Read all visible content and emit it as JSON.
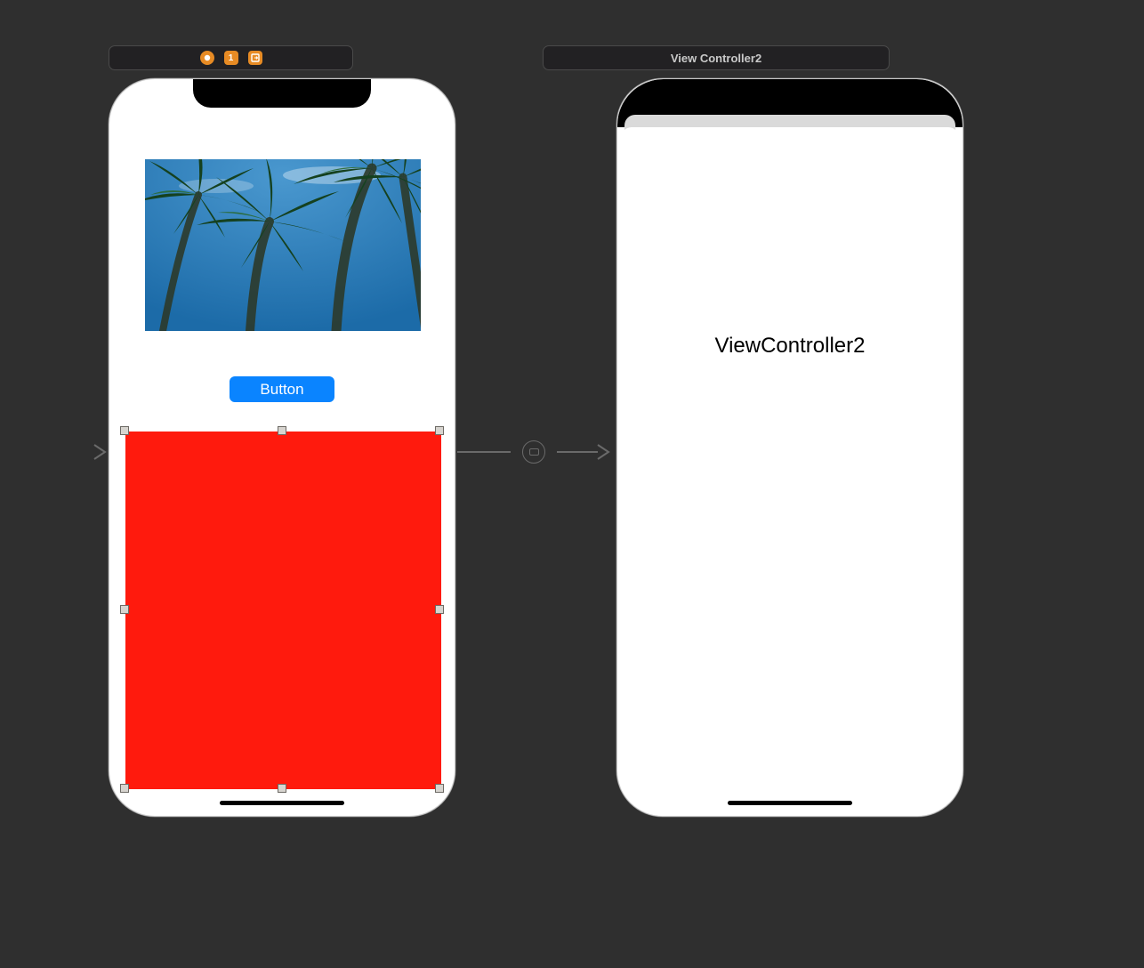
{
  "scene1": {
    "toolbar": {
      "entry_point_icon": "entry-point-badge",
      "count_badge": "1",
      "exit_icon": "exit-badge"
    },
    "button_label": "Button",
    "container_color": "#ff1a0d"
  },
  "scene2": {
    "title": "View Controller2",
    "label": "ViewController2"
  }
}
